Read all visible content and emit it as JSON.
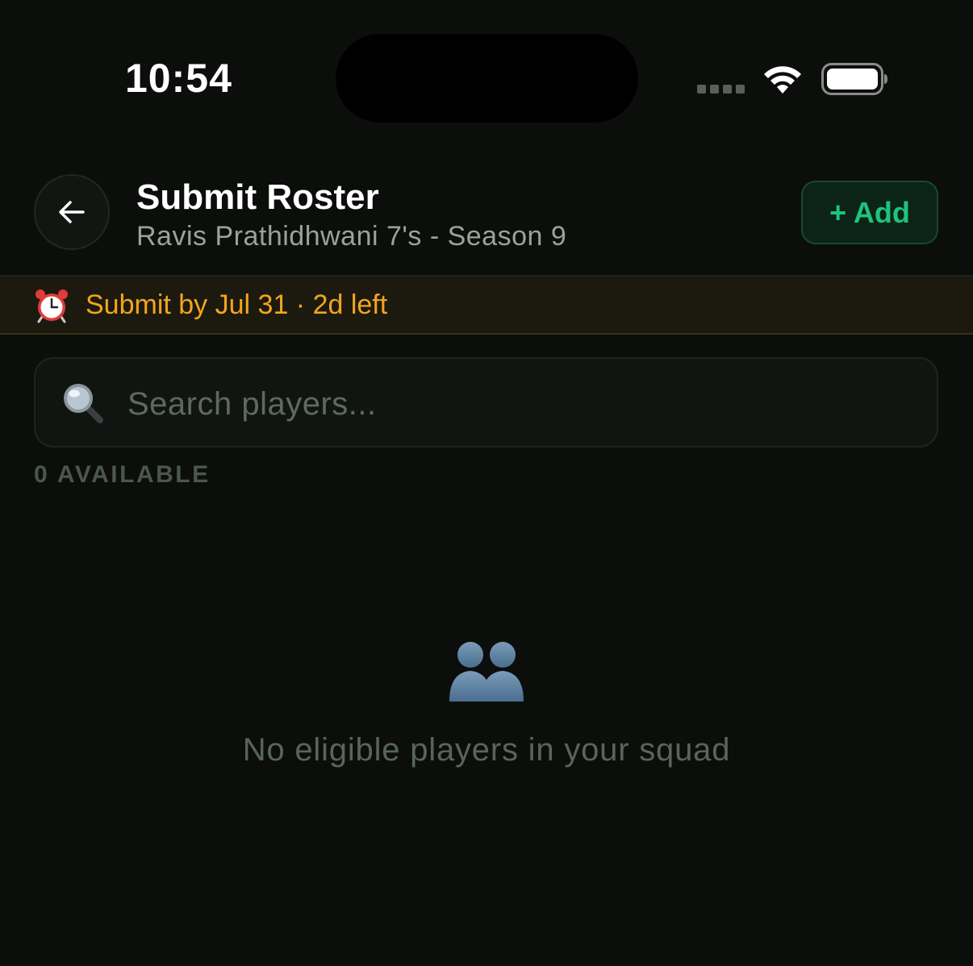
{
  "status_bar": {
    "time": "10:54",
    "wifi_icon": "wifi-icon",
    "battery_icon": "battery-full-icon",
    "signal_icon": "signal-dots-icon"
  },
  "header": {
    "back_icon": "arrow-left-icon",
    "title": "Submit Roster",
    "subtitle": "Ravis Prathidhwani 7's - Season 9",
    "add_label": "+ Add"
  },
  "deadline": {
    "icon": "alarm-clock-icon",
    "text": "Submit by Jul 31 · 2d left",
    "color": "#f2a51e"
  },
  "search": {
    "icon": "magnifying-glass-icon",
    "placeholder": "Search players...",
    "value": ""
  },
  "list": {
    "available_label": "0 AVAILABLE"
  },
  "empty_state": {
    "icon": "two-people-silhouette-icon",
    "message": "No eligible players in your squad"
  },
  "colors": {
    "background": "#0c0e0c",
    "accent": "#1ec47a",
    "warning": "#f2a51e"
  }
}
